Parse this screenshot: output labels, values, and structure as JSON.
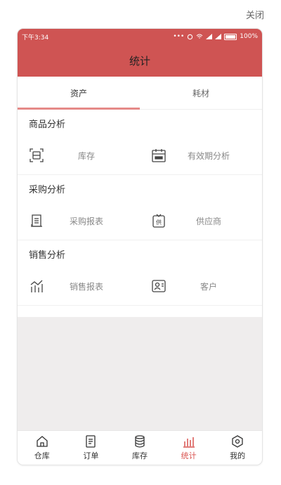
{
  "close_label": "关闭",
  "status_bar": {
    "time": "下午3:34",
    "battery": "100%"
  },
  "title": "统计",
  "tabs": [
    {
      "label": "资产",
      "active": true
    },
    {
      "label": "耗材",
      "active": false
    }
  ],
  "sections": [
    {
      "title": "商品分析",
      "items": [
        {
          "label": "库存",
          "icon": "scan-box-icon"
        },
        {
          "label": "有效期分析",
          "icon": "calendar-icon"
        }
      ]
    },
    {
      "title": "采购分析",
      "items": [
        {
          "label": "采购报表",
          "icon": "purchase-report-icon"
        },
        {
          "label": "供应商",
          "icon": "supplier-icon"
        }
      ]
    },
    {
      "title": "销售分析",
      "items": [
        {
          "label": "销售报表",
          "icon": "sales-chart-icon"
        },
        {
          "label": "客户",
          "icon": "customer-icon"
        }
      ]
    }
  ],
  "bottom_nav": [
    {
      "label": "仓库",
      "icon": "warehouse-home-icon",
      "active": false
    },
    {
      "label": "订单",
      "icon": "order-doc-icon",
      "active": false
    },
    {
      "label": "库存",
      "icon": "inventory-stack-icon",
      "active": false
    },
    {
      "label": "统计",
      "icon": "statistics-bar-icon",
      "active": true
    },
    {
      "label": "我的",
      "icon": "profile-hexagon-icon",
      "active": false
    }
  ],
  "colors": {
    "accent": "#cf5453",
    "tab_indicator": "#e58a88",
    "nav_active": "#d9534f",
    "background_gray": "#efeded"
  }
}
